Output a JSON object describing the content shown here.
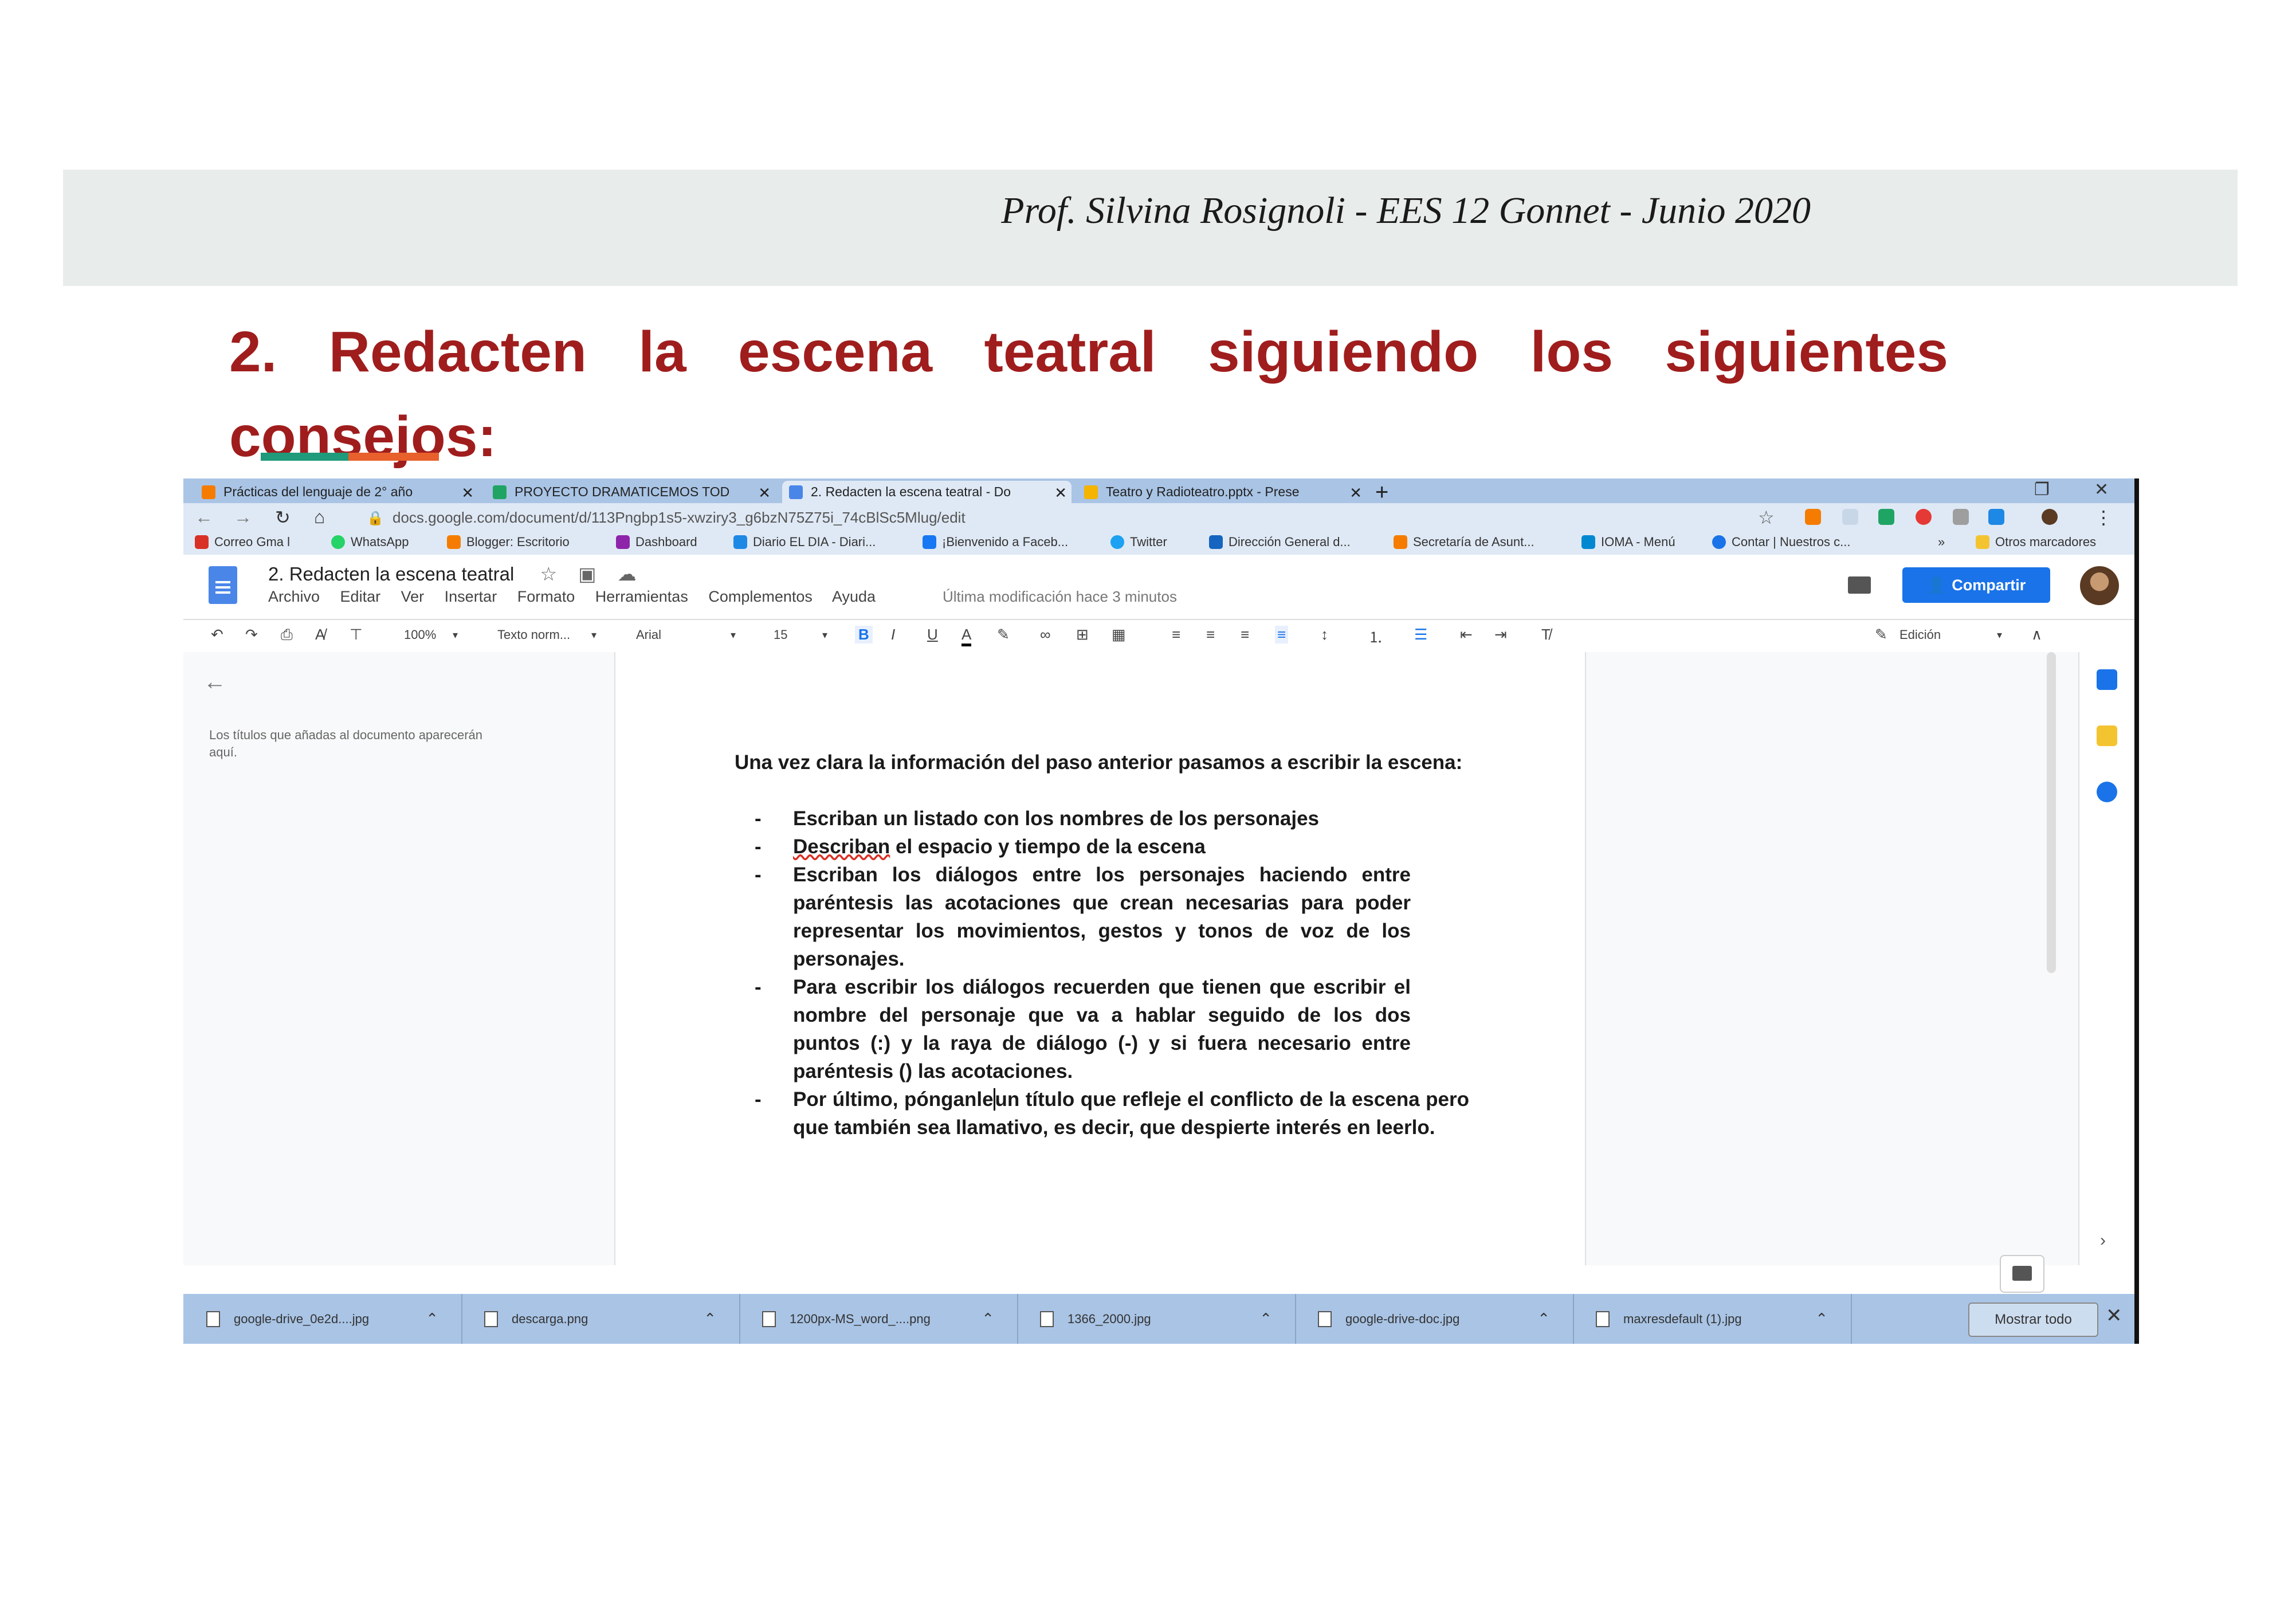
{
  "header": {
    "text": "Prof. Silvina Rosignoli - EES 12 Gonnet - Junio 2020"
  },
  "heading": {
    "text": "2. Redacten la escena teatral siguiendo los siguientes consejos:"
  },
  "browser": {
    "tabs": [
      {
        "label": "Prácticas del lenguaje de 2° año",
        "icon": "blogger-icon",
        "color": "#f57c00"
      },
      {
        "label": "PROYECTO DRAMATICEMOS TOD",
        "icon": "drive-icon",
        "color": "#1fa463"
      },
      {
        "label": "2. Redacten la escena teatral - Do",
        "icon": "docs-icon",
        "color": "#4a86e8"
      },
      {
        "label": "Teatro y Radioteatro.pptx - Prese",
        "icon": "slides-icon",
        "color": "#f4b400"
      }
    ],
    "new_tab": "+",
    "url": "docs.google.com/document/d/113Pngbp1s5-xwziry3_g6bzN75Z75i_74cBlSc5Mlug/edit",
    "bookmarks": [
      {
        "label": "Correo Gma l",
        "color": "#d93025"
      },
      {
        "label": "WhatsApp",
        "color": "#25d366"
      },
      {
        "label": "Blogger: Escritorio",
        "color": "#f57c00"
      },
      {
        "label": "Dashboard",
        "color": "#8e24aa"
      },
      {
        "label": "Diario EL DIA - Diari...",
        "color": "#1e88e5"
      },
      {
        "label": "¡Bienvenido a Faceb...",
        "color": "#1877f2"
      },
      {
        "label": "Twitter",
        "color": "#1da1f2"
      },
      {
        "label": "Dirección General d...",
        "color": "#1565c0"
      },
      {
        "label": "Secretaría de Asunt...",
        "color": "#f57c00"
      },
      {
        "label": "IOMA - Menú",
        "color": "#0288d1"
      },
      {
        "label": "Contar | Nuestros c...",
        "color": "#1a73e8"
      }
    ],
    "more_bookmarks": "»",
    "other_bookmarks": "Otros marcadores"
  },
  "docs": {
    "title": "2. Redacten la escena teatral",
    "menus": [
      "Archivo",
      "Editar",
      "Ver",
      "Insertar",
      "Formato",
      "Herramientas",
      "Complementos",
      "Ayuda"
    ],
    "last_modified": "Última modificación hace 3 minutos",
    "share_label": "Compartir",
    "toolbar": {
      "zoom": "100%",
      "style": "Texto norm...",
      "font": "Arial",
      "size": "15",
      "mode": "Edición"
    },
    "outline_hint": "Los títulos que añadas al documento aparecerán aquí.",
    "body": {
      "intro": "Una vez clara la información del paso anterior pasamos a escribir la escena:",
      "items": [
        "Escriban un listado con los nombres de los personajes",
        "el espacio y tiempo de la escena",
        "Escriban los diálogos entre los personajes haciendo entre paréntesis las acotaciones que crean necesarias para poder representar los movimientos, gestos y tonos de voz de los personajes.",
        "Para escribir los diálogos recuerden que tienen que escribir el nombre del personaje que va a hablar seguido de los dos puntos (:) y la raya de diálogo (-) y si fuera necesario entre paréntesis () las acotaciones.",
        "un título que refleje el conflicto de la escena pero que también sea llamativo, es decir, que despierte interés en leerlo."
      ],
      "item2_lead": "Describan",
      "item5_lead": "Por último, pónganle"
    }
  },
  "downloads": {
    "files": [
      "google-drive_0e2d....jpg",
      "descarga.png",
      "1200px-MS_word_....png",
      "1366_2000.jpg",
      "google-drive-doc.jpg",
      "maxresdefault (1).jpg"
    ],
    "show_all": "Mostrar todo"
  }
}
